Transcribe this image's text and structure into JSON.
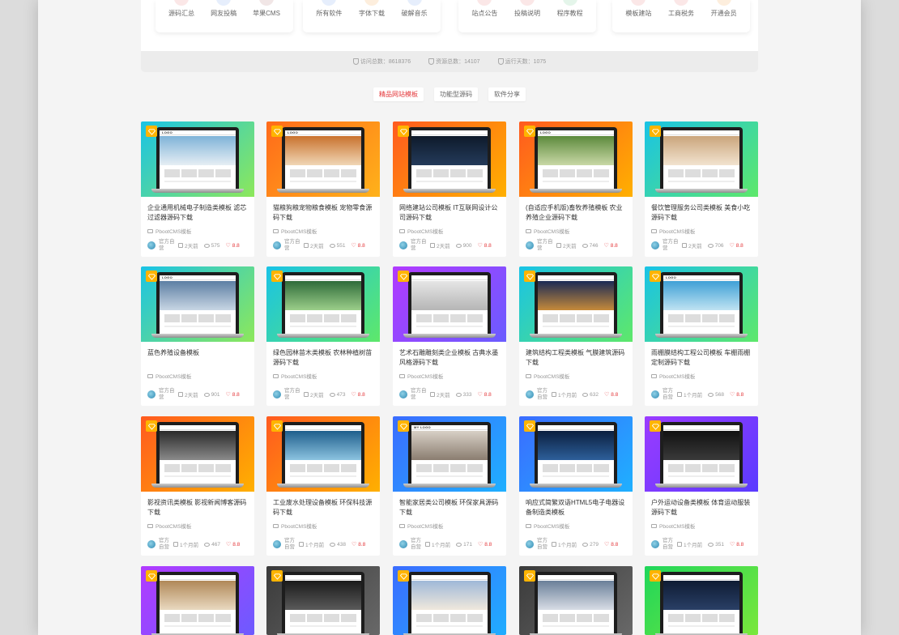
{
  "nav_groups": [
    {
      "items": [
        {
          "label": "源码汇总",
          "tone": "red"
        },
        {
          "label": "网友投稿",
          "tone": "blue"
        },
        {
          "label": "苹果CMS",
          "tone": "dark"
        }
      ]
    },
    {
      "items": [
        {
          "label": "所有软件",
          "tone": "blue"
        },
        {
          "label": "字体下载",
          "tone": "orange"
        },
        {
          "label": "破解音乐",
          "tone": "blue"
        }
      ]
    },
    {
      "items": [
        {
          "label": "站点公告",
          "tone": "red"
        },
        {
          "label": "投稿说明",
          "tone": "red"
        },
        {
          "label": "程序教程",
          "tone": "green"
        }
      ]
    },
    {
      "items": [
        {
          "label": "模板建站",
          "tone": "red"
        },
        {
          "label": "工商税务",
          "tone": "red"
        },
        {
          "label": "开通会员",
          "tone": "orange"
        }
      ]
    }
  ],
  "stats": {
    "visits": "访问总数：8618376",
    "resources": "资源总数：14107",
    "days": "运行天数：1075"
  },
  "tabs": [
    {
      "label": "精品网站模板",
      "active": true
    },
    {
      "label": "功能型源码",
      "active": false
    },
    {
      "label": "软件分享",
      "active": false
    }
  ],
  "cards": [
    {
      "title": "企业通用机械电子制造类模板 滤芯过滤器源码下载",
      "category": "PbootCMS模板",
      "author": "官方自营",
      "time": "2天前",
      "views": "575",
      "score": "8.8",
      "bg": [
        "#19c3e6",
        "#8de85a"
      ],
      "logo": "LOGO",
      "hero": [
        "#7fb3d8",
        "#e6eef4"
      ]
    },
    {
      "title": "猫粮狗粮宠物粮食模板 宠物零食源码下载",
      "category": "PbootCMS模板",
      "author": "官方自营",
      "time": "2天前",
      "views": "551",
      "score": "8.8",
      "bg": [
        "#ff6a1a",
        "#ffb21a"
      ],
      "logo": "LOGO",
      "hero": [
        "#c9722d",
        "#f0d6b5"
      ]
    },
    {
      "title": "网络建站公司模板 IT互联网设计公司源码下载",
      "category": "PbootCMS模板",
      "author": "官方自营",
      "time": "2天前",
      "views": "900",
      "score": "8.8",
      "bg": [
        "#ff5a1f",
        "#ffb000"
      ],
      "logo": "",
      "hero": [
        "#0e1a2b",
        "#243b5a"
      ]
    },
    {
      "title": "(自适应手机版)畜牧养殖模板 农业养殖企业源码下载",
      "category": "PbootCMS模板",
      "author": "官方自营",
      "time": "2天前",
      "views": "746",
      "score": "8.8",
      "bg": [
        "#ff5a1f",
        "#ffb000"
      ],
      "logo": "LOGO",
      "hero": [
        "#5c8a3c",
        "#c9d8a6"
      ]
    },
    {
      "title": "餐饮管理服务公司类模板 美食小吃源码下载",
      "category": "PbootCMS模板",
      "author": "官方自营",
      "time": "2天前",
      "views": "706",
      "score": "8.8",
      "bg": [
        "#19c3e6",
        "#5ee86a"
      ],
      "logo": "",
      "hero": [
        "#caa57c",
        "#f2e3cf"
      ]
    },
    {
      "title": "蓝色养殖设备模板",
      "category": "PbootCMS模板",
      "author": "官方自营",
      "time": "2天前",
      "views": "901",
      "score": "8.8",
      "bg": [
        "#19c3e6",
        "#8de85a"
      ],
      "logo": "LOGO",
      "hero": [
        "#5d7fa3",
        "#c8d6e4"
      ]
    },
    {
      "title": "绿色园林苗木类模板 农林种植树苗源码下载",
      "category": "PbootCMS模板",
      "author": "官方自营",
      "time": "2天前",
      "views": "473",
      "score": "8.8",
      "bg": [
        "#19c3e6",
        "#5ee86a"
      ],
      "logo": "",
      "hero": [
        "#2f6b3a",
        "#9ccf8a"
      ]
    },
    {
      "title": "艺术石雕雕刻类企业模板 古典水墨风格源码下载",
      "category": "PbootCMS模板",
      "author": "官方自营",
      "time": "2天前",
      "views": "333",
      "score": "8.8",
      "bg": [
        "#b23aff",
        "#6a5cff"
      ],
      "logo": "",
      "hero": [
        "#e6e6e6",
        "#b5b5b5"
      ]
    },
    {
      "title": "建筑结构工程类模板 气膜建筑源码下载",
      "category": "PbootCMS模板",
      "author": "官方自营",
      "time": "1个月前",
      "views": "632",
      "score": "8.8",
      "bg": [
        "#19c3e6",
        "#5ee86a"
      ],
      "logo": "",
      "hero": [
        "#1a2a55",
        "#c58a3a"
      ]
    },
    {
      "title": "雨棚膜结构工程公司模板 车棚雨棚定制源码下载",
      "category": "PbootCMS模板",
      "author": "官方自营",
      "time": "1个月前",
      "views": "568",
      "score": "8.8",
      "bg": [
        "#19c3e6",
        "#5ee86a"
      ],
      "logo": "LOGO",
      "hero": [
        "#3fa0d6",
        "#bfe3f2"
      ]
    },
    {
      "title": "影视资讯类模板 影视新闻博客源码下载",
      "category": "PbootCMS模板",
      "author": "官方自营",
      "time": "1个月前",
      "views": "467",
      "score": "8.8",
      "bg": [
        "#ff5a1f",
        "#ffb000"
      ],
      "logo": "",
      "hero": [
        "#2a2a2a",
        "#8a8a8a"
      ]
    },
    {
      "title": "工业废水处理设备模板 环保科技源码下载",
      "category": "PbootCMS模板",
      "author": "官方自营",
      "time": "1个月前",
      "views": "438",
      "score": "8.8",
      "bg": [
        "#ff5a1f",
        "#ffb000"
      ],
      "logo": "",
      "hero": [
        "#1f5f8c",
        "#8cc3e0"
      ]
    },
    {
      "title": "智能家居类公司模板 环保家具源码下载",
      "category": "PbootCMS模板",
      "author": "官方自营",
      "time": "1个月前",
      "views": "171",
      "score": "8.8",
      "bg": [
        "#3b6cff",
        "#1fb0ff"
      ],
      "logo": "MY LOGO",
      "hero": [
        "#d8d0c6",
        "#8a7d70"
      ]
    },
    {
      "title": "响应式简繁双语HTML5电子电器设备制造类模板",
      "category": "PbootCMS模板",
      "author": "官方自营",
      "time": "1个月前",
      "views": "279",
      "score": "8.8",
      "bg": [
        "#3b6cff",
        "#1fb0ff"
      ],
      "logo": "",
      "hero": [
        "#0b1f3f",
        "#2d5f9a"
      ]
    },
    {
      "title": "户外运动设备类模板 体育运动服装源码下载",
      "category": "PbootCMS模板",
      "author": "官方自营",
      "time": "1个月前",
      "views": "351",
      "score": "8.8",
      "bg": [
        "#9b3bff",
        "#5a3bff"
      ],
      "logo": "",
      "hero": [
        "#111111",
        "#3a3a3a"
      ]
    },
    {
      "title": "",
      "category": "",
      "author": "",
      "time": "",
      "views": "",
      "score": "",
      "bg": [
        "#b23aff",
        "#6a5cff"
      ],
      "logo": "",
      "hero": [
        "#b08858",
        "#e9d9c0"
      ]
    },
    {
      "title": "",
      "category": "",
      "author": "",
      "time": "",
      "views": "",
      "score": "",
      "bg": [
        "#3a3a3a",
        "#6a6a6a"
      ],
      "logo": "",
      "hero": [
        "#1a1a1a",
        "#5a5a5a"
      ]
    },
    {
      "title": "",
      "category": "",
      "author": "",
      "time": "",
      "views": "",
      "score": "",
      "bg": [
        "#3b6cff",
        "#1fb0ff"
      ],
      "logo": "",
      "hero": [
        "#9fb8d8",
        "#f0e8dc"
      ]
    },
    {
      "title": "",
      "category": "",
      "author": "",
      "time": "",
      "views": "",
      "score": "",
      "bg": [
        "#3a3a3a",
        "#6a6a6a"
      ],
      "logo": "",
      "hero": [
        "#6a7f99",
        "#d8dde5"
      ]
    },
    {
      "title": "",
      "category": "",
      "author": "",
      "time": "",
      "views": "",
      "score": "",
      "bg": [
        "#1fd65a",
        "#7ee83a"
      ],
      "logo": "",
      "hero": [
        "#0e1b33",
        "#2a3f66"
      ]
    }
  ]
}
